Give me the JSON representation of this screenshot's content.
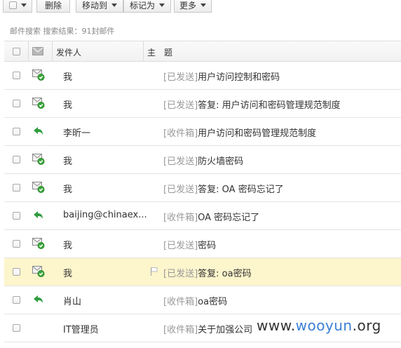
{
  "toolbar": {
    "delete_label": "删除",
    "move_label": "移动到",
    "markas_label": "标记为",
    "more_label": "更多"
  },
  "search_info": "邮件搜索 搜索结果：91封邮件",
  "columns": {
    "sender": "发件人",
    "subject": "主　题"
  },
  "rows": [
    {
      "sender": "我",
      "folder": "[已发送]",
      "subject": "用户访问控制和密码",
      "icon": "sent-mail-icon"
    },
    {
      "sender": "我",
      "folder": "[已发送]",
      "subject": "答复: 用户访问和密码管理规范制度",
      "icon": "sent-mail-icon"
    },
    {
      "sender": "李昕一",
      "folder": "[收件箱]",
      "subject": "用户访问和密码管理规范制度",
      "icon": "reply-arrow-icon"
    },
    {
      "sender": "我",
      "folder": "[已发送]",
      "subject": "防火墙密码",
      "icon": "sent-mail-icon"
    },
    {
      "sender": "我",
      "folder": "[已发送]",
      "subject": "答复: OA 密码忘记了",
      "icon": "sent-mail-icon"
    },
    {
      "sender": "baijing@chinaex...",
      "folder": "[收件箱]",
      "subject": "OA 密码忘记了",
      "icon": "reply-arrow-icon"
    },
    {
      "sender": "我",
      "folder": "[已发送]",
      "subject": "密码",
      "icon": "sent-mail-icon"
    },
    {
      "sender": "我",
      "folder": "[已发送]",
      "subject": "答复: oa密码",
      "icon": "sent-mail-icon"
    },
    {
      "sender": "肖山",
      "folder": "[收件箱]",
      "subject": "oa密码",
      "icon": "reply-arrow-icon"
    },
    {
      "sender": "IT管理员",
      "folder": "[收件箱]",
      "subject": "关于加强公司",
      "icon": "none"
    }
  ],
  "watermark": {
    "a": "www.",
    "b": "wooyun",
    "c": ".org"
  },
  "colors": {
    "highlight_row": "#fdf5cc",
    "folder_tag": "#999999",
    "sent_check_green": "#3aa53a",
    "reply_arrow_green": "#2e9c3c"
  }
}
